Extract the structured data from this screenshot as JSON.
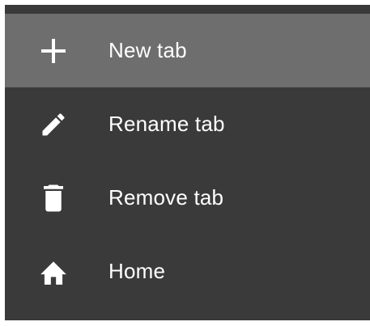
{
  "menu": {
    "items": [
      {
        "label": "New tab",
        "icon": "plus-icon",
        "selected": true
      },
      {
        "label": "Rename tab",
        "icon": "pencil-icon",
        "selected": false
      },
      {
        "label": "Remove tab",
        "icon": "trash-icon",
        "selected": false
      },
      {
        "label": "Home",
        "icon": "home-icon",
        "selected": false
      }
    ]
  },
  "colors": {
    "menu_background": "#3a3a3a",
    "selected_background": "#6e6e6e",
    "text": "#ffffff",
    "icon": "#ffffff"
  }
}
